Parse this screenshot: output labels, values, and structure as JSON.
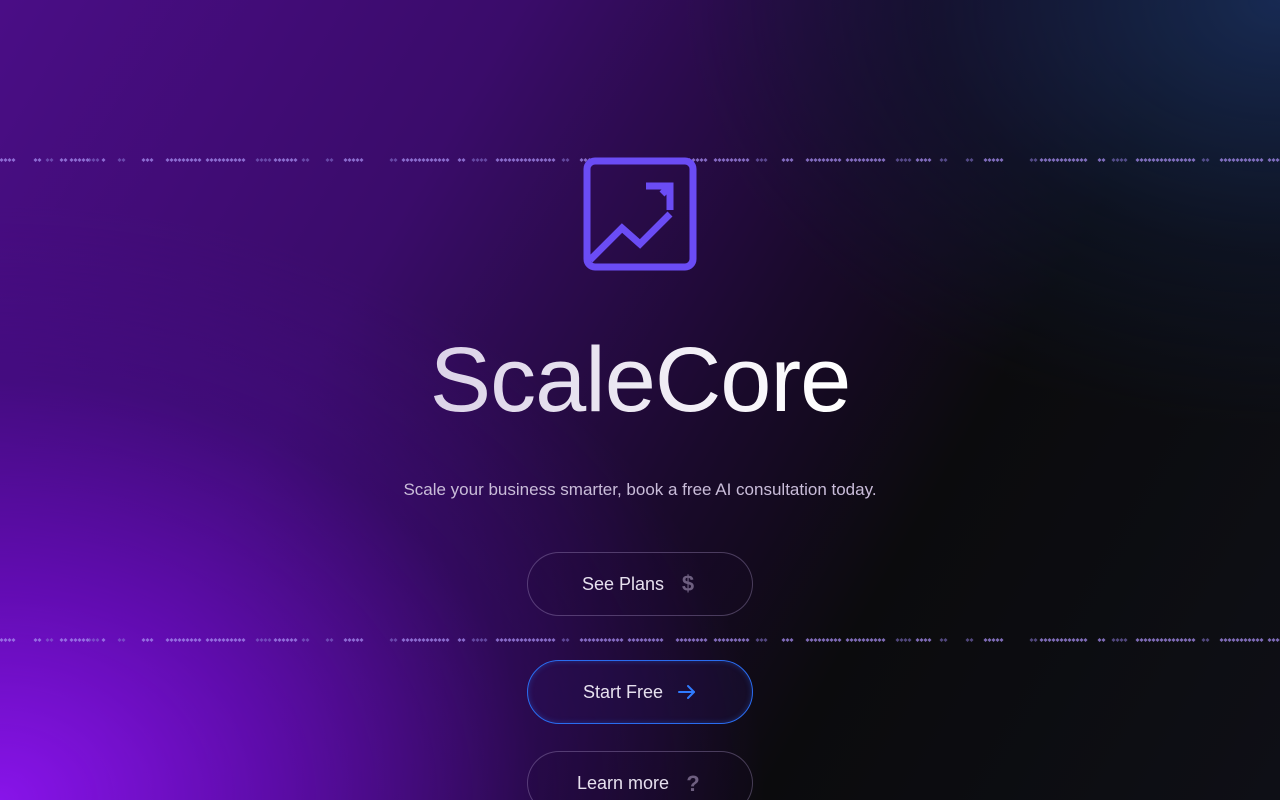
{
  "brand": {
    "name": "ScaleCore",
    "logo_icon": "trending-up-square-icon",
    "tagline": "Scale your business smarter, book a free AI consultation today."
  },
  "buttons": {
    "see_plans": {
      "label": "See Plans",
      "icon": "dollar-icon"
    },
    "start_free": {
      "label": "Start Free",
      "icon": "arrow-right-icon"
    },
    "learn_more": {
      "label": "Learn more",
      "icon": "question-icon"
    }
  },
  "colors": {
    "accent_purple": "#6b4cf5",
    "start_border": "#2a6cf0",
    "arrow_blue": "#2f7bff",
    "muted_icon": "#6e5f80"
  }
}
